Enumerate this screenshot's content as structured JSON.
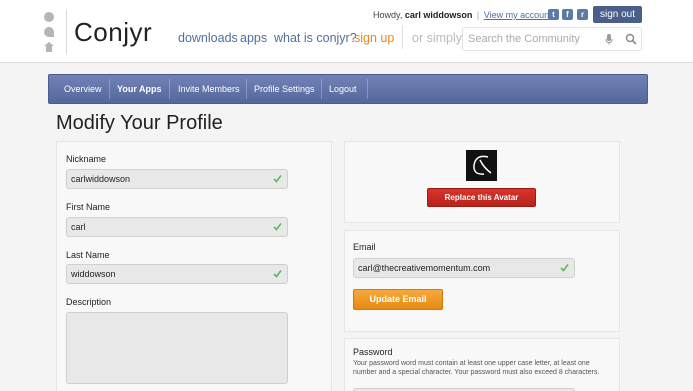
{
  "header": {
    "logo": "Conjyr",
    "nav": {
      "downloads": "downloads",
      "apps": "apps",
      "what": "what is conjyr?",
      "signup": "sign up",
      "or_simply": "or simply"
    },
    "search": {
      "placeholder": "Search the Community"
    },
    "user": {
      "howdy": "Howdy,",
      "name": "carl widdowson",
      "pipe": "|",
      "view_account": "View my account"
    },
    "social": {
      "twitter": "t",
      "facebook": "f",
      "rss": "r"
    },
    "signout": "sign out"
  },
  "tabs": [
    {
      "label": "Overview"
    },
    {
      "label": "Your Apps"
    },
    {
      "label": "Invite Members"
    },
    {
      "label": "Profile Settings"
    },
    {
      "label": "Logout"
    }
  ],
  "page_title": "Modify Your Profile",
  "profile": {
    "nickname_label": "Nickname",
    "nickname": "carlwiddowson",
    "first_name_label": "First Name",
    "first_name": "carl",
    "last_name_label": "Last Name",
    "last_name": "widdowson",
    "description_label": "Description"
  },
  "avatar": {
    "replace_label": "Replace this Avatar"
  },
  "email": {
    "label": "Email",
    "value": "carl@thecreativemomentum.com",
    "update_label": "Update Email"
  },
  "password": {
    "label": "Password",
    "help": "Your password word must contain at least one upper case letter, at least one number and a special character. Your password must also exceed 8 characters."
  },
  "colors": {
    "accent_blue": "#5a6ba2",
    "signup_orange": "#e6891a",
    "danger_red": "#c92b22",
    "update_orange": "#f0991f",
    "check_green": "#5cb85c"
  }
}
